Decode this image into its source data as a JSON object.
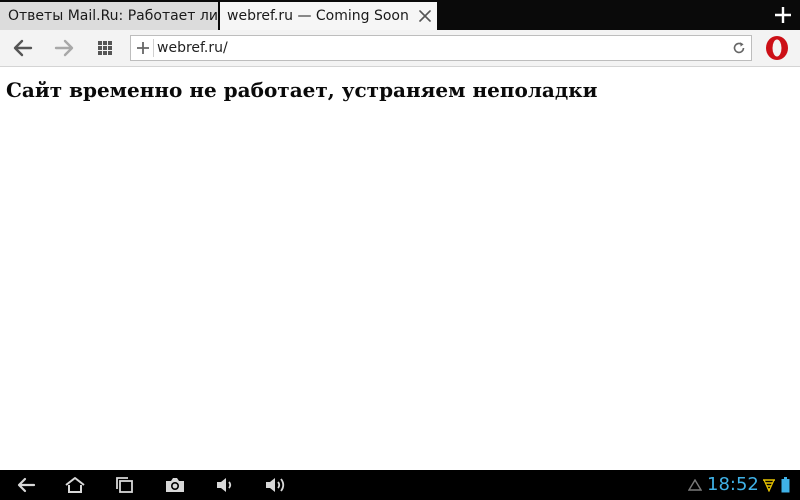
{
  "tabs": [
    {
      "title": "Ответы Mail.Ru: Работает ли у",
      "active": false
    },
    {
      "title": "webref.ru — Coming Soon",
      "active": true
    }
  ],
  "address_bar": {
    "url": "webref.ru/"
  },
  "page": {
    "heading": "Сайт временно не работает, устраняем неполадки"
  },
  "system_bar": {
    "clock": "18:52"
  },
  "colors": {
    "tabstrip_bg": "#0a0a0a",
    "active_tab_bg": "#f6f6f6",
    "inactive_tab_bg": "#dcdcdc",
    "opera_red": "#cc0f16",
    "clock_color": "#3fb1e6",
    "wifi_color": "#e8c400"
  },
  "icons": {
    "toolbar": [
      "back-arrow-icon",
      "forward-arrow-icon",
      "speed-dial-grid-icon",
      "plus-icon",
      "reload-icon",
      "opera-logo-icon"
    ],
    "system": [
      "back-icon",
      "home-icon",
      "recent-apps-icon",
      "camera-icon",
      "volume-down-icon",
      "volume-up-icon",
      "notification-icon",
      "wifi-icon",
      "battery-icon"
    ]
  }
}
